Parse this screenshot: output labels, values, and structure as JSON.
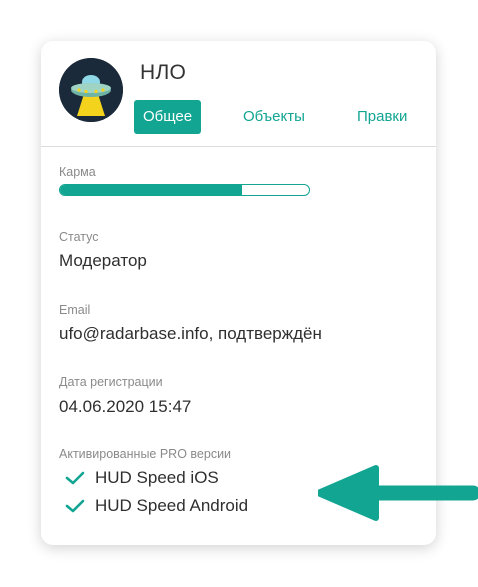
{
  "profile": {
    "username": "НЛО",
    "avatar_icon": "ufo-icon"
  },
  "tabs": [
    {
      "label": "Общее",
      "active": true
    },
    {
      "label": "Объекты",
      "active": false
    },
    {
      "label": "Правки",
      "active": false
    }
  ],
  "karma": {
    "label": "Карма",
    "level_percent": 73
  },
  "status": {
    "label": "Статус",
    "value": "Модератор"
  },
  "email": {
    "label": "Email",
    "value": "ufo@radarbase.info, подтверждён"
  },
  "registration": {
    "label": "Дата регистрации",
    "value": "04.06.2020 15:47"
  },
  "pro": {
    "label": "Активированные PRO версии",
    "items": [
      "HUD Speed iOS",
      "HUD Speed Android"
    ]
  },
  "colors": {
    "accent": "#12a592",
    "arrow": "#12a592",
    "avatar_bg": "#1b2a3a"
  },
  "annotation_icon": "arrow-left-icon"
}
